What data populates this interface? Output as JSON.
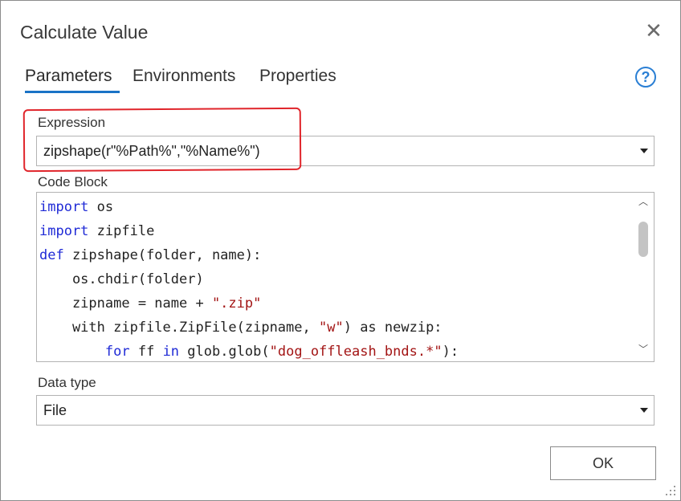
{
  "window": {
    "title": "Calculate Value",
    "close_glyph": "✕"
  },
  "tabs": [
    {
      "label": "Parameters",
      "active": true
    },
    {
      "label": "Environments",
      "active": false
    },
    {
      "label": "Properties",
      "active": false
    }
  ],
  "help_glyph": "?",
  "expression": {
    "label": "Expression",
    "value": "zipshape(r\"%Path%\",\"%Name%\")"
  },
  "code_block": {
    "label": "Code Block",
    "lines": [
      [
        {
          "t": "import",
          "c": "kw"
        },
        {
          "t": " os",
          "c": ""
        }
      ],
      [
        {
          "t": "import",
          "c": "kw"
        },
        {
          "t": " zipfile",
          "c": ""
        }
      ],
      [
        {
          "t": "def",
          "c": "kw"
        },
        {
          "t": " zipshape(folder, name):",
          "c": ""
        }
      ],
      [
        {
          "t": "    os.chdir(folder)",
          "c": ""
        }
      ],
      [
        {
          "t": "    zipname = name + ",
          "c": ""
        },
        {
          "t": "\".zip\"",
          "c": "str"
        }
      ],
      [
        {
          "t": "    with zipfile.ZipFile(zipname, ",
          "c": ""
        },
        {
          "t": "\"w\"",
          "c": "str"
        },
        {
          "t": ") as newzip:",
          "c": ""
        }
      ],
      [
        {
          "t": "        ",
          "c": ""
        },
        {
          "t": "for",
          "c": "kw"
        },
        {
          "t": " ff ",
          "c": ""
        },
        {
          "t": "in",
          "c": "kw"
        },
        {
          "t": " glob.glob(",
          "c": ""
        },
        {
          "t": "\"dog_offleash_bnds.*\"",
          "c": "str"
        },
        {
          "t": "):",
          "c": ""
        }
      ]
    ]
  },
  "data_type": {
    "label": "Data type",
    "value": "File"
  },
  "buttons": {
    "ok_label": "OK"
  },
  "colors": {
    "accent": "#1a73c6",
    "keyword": "#1f2ad6",
    "string": "#a31515",
    "annotation": "#e0252b"
  }
}
